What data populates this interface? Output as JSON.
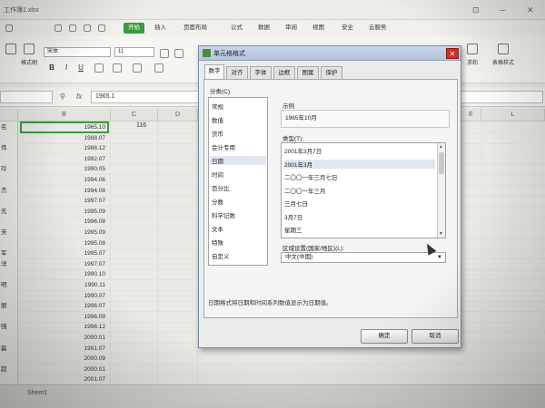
{
  "window": {
    "doc_tab": "工作簿1.xlsx",
    "controls": [
      "⊡",
      "─",
      "✕"
    ]
  },
  "menu": {
    "items": [
      "开始",
      "插入",
      "页面布局",
      "公式",
      "数据",
      "审阅",
      "视图",
      "安全",
      "云服务"
    ],
    "active_index": 0
  },
  "toolbar": {
    "format_painter": "格式刷",
    "font_name": "宋体",
    "font_size": "11",
    "bold": "B",
    "italic": "I",
    "underline": "U",
    "right_items": [
      "求和",
      "表格样式"
    ]
  },
  "formula_bar": {
    "fx": "fx",
    "value": "1965.1"
  },
  "columns": [
    "B",
    "C",
    "D",
    "E",
    "L"
  ],
  "rows": [
    {
      "a": "名",
      "b": "1965.10"
    },
    {
      "a": "",
      "b": "1988.07"
    },
    {
      "a": "伟",
      "b": "1988.12"
    },
    {
      "a": "",
      "b": "1992.07"
    },
    {
      "a": "玲",
      "b": "1990.05"
    },
    {
      "a": "",
      "b": "1994.06"
    },
    {
      "a": "杰",
      "b": "1994.08"
    },
    {
      "a": "",
      "b": "1997.07"
    },
    {
      "a": "先",
      "b": "1995.09"
    },
    {
      "a": "",
      "b": "1996.08"
    },
    {
      "a": "芳",
      "b": "1995.09"
    },
    {
      "a": "",
      "b": "1995.08"
    },
    {
      "a": "军",
      "b": "1995.07"
    },
    {
      "a": "洋",
      "b": "1997.07"
    },
    {
      "a": "",
      "b": "1990.10"
    },
    {
      "a": "明",
      "b": "1990.11"
    },
    {
      "a": "",
      "b": "1990.07"
    },
    {
      "a": "丽",
      "b": "1996.07"
    },
    {
      "a": "",
      "b": "1996.09"
    },
    {
      "a": "强",
      "b": "1996.12"
    },
    {
      "a": "",
      "b": "2000.01"
    },
    {
      "a": "磊",
      "b": "1991.07"
    },
    {
      "a": "",
      "b": "2000.09"
    },
    {
      "a": "超",
      "b": "2000.01"
    },
    {
      "a": "",
      "b": "2001.07"
    }
  ],
  "cell_c1": "116",
  "sheet": {
    "tab": "Sheet1"
  },
  "dialog": {
    "title": "单元格格式",
    "close": "✕",
    "tabs": [
      "数字",
      "对齐",
      "字体",
      "边框",
      "图案",
      "保护"
    ],
    "active_tab": 0,
    "category_label": "分类(C):",
    "categories": [
      "常规",
      "数值",
      "货币",
      "会计专用",
      "日期",
      "时间",
      "百分比",
      "分数",
      "科学记数",
      "文本",
      "特殊",
      "自定义"
    ],
    "selected_category": 4,
    "sample_label": "示例",
    "sample_value": "1965年10月",
    "type_label": "类型(T):",
    "types": [
      "2001年3月7日",
      "2001年3月",
      "二〇〇一年三月七日",
      "二〇〇一年三月",
      "三月七日",
      "3月7日",
      "星期三"
    ],
    "selected_type": 1,
    "locale_label": "区域设置(国家/地区)(L):",
    "locale_value": "中文(中国)",
    "description": "日期格式将日期和时间系列数值显示为日期值。",
    "ok": "确定",
    "cancel": "取消"
  }
}
